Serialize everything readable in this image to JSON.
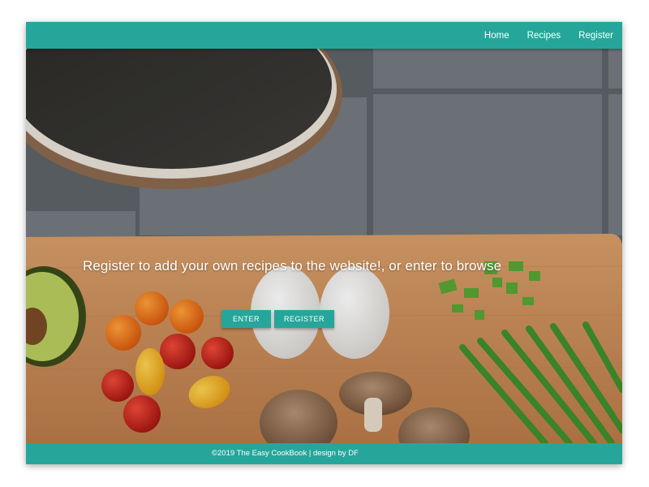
{
  "nav": {
    "items": [
      {
        "label": "Home"
      },
      {
        "label": "Recipes"
      },
      {
        "label": "Register"
      }
    ]
  },
  "hero": {
    "tagline": "Register to add your own recipes to the website!, or enter to browse",
    "image_icon": "kitchen-cutting-board-photo",
    "buttons": {
      "enter_label": "ENTER",
      "register_label": "REGISTER"
    }
  },
  "footer": {
    "text": "©2019 The Easy CookBook | design by DF"
  },
  "colors": {
    "accent": "#26a69a",
    "board": "#c98f5e",
    "tile": "#6f7478"
  }
}
